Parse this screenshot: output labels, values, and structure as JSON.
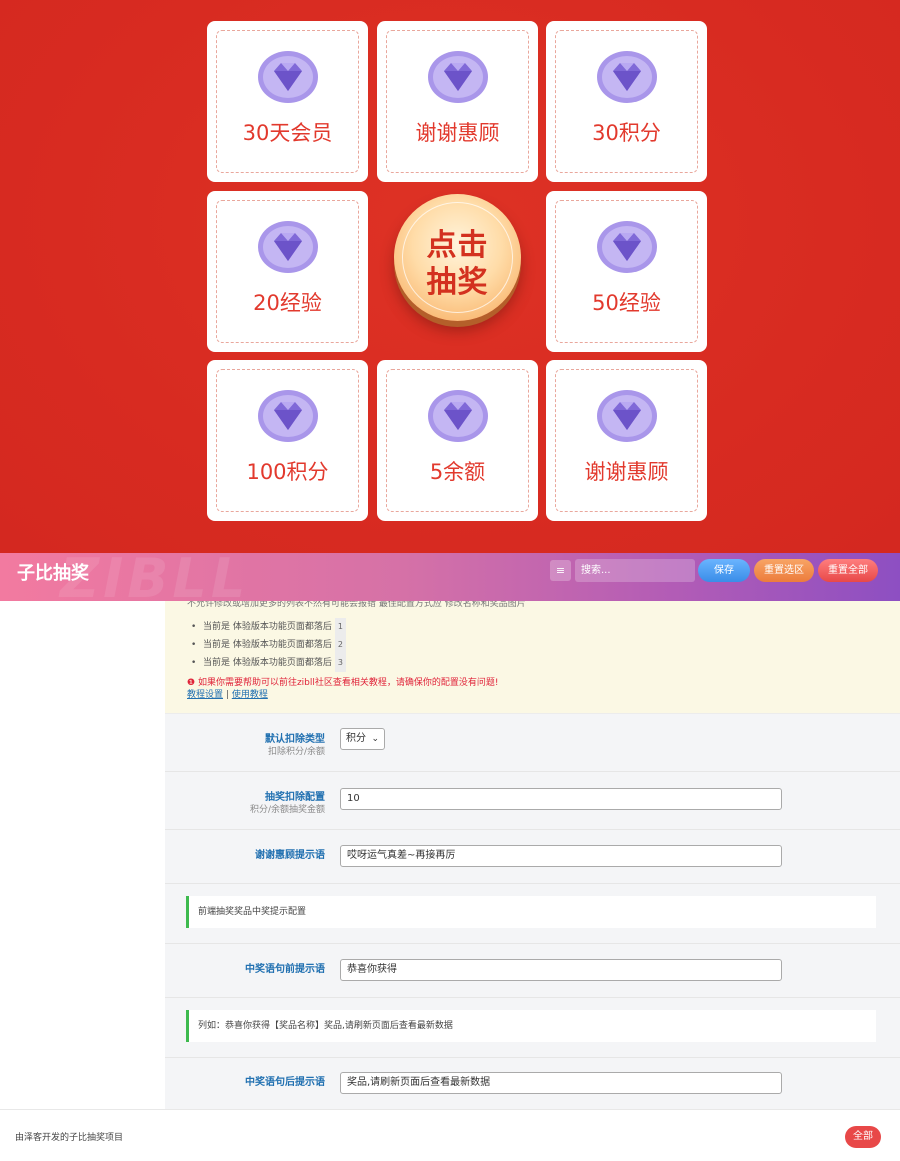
{
  "lottery": {
    "prizes": [
      "30天会员",
      "谢谢惠顾",
      "30积分",
      "20经验",
      "50经验",
      "100积分",
      "5余额",
      "谢谢惠顾"
    ],
    "draw_button": {
      "line1": "点击",
      "line2": "抽奖"
    },
    "icon": "gem-icon",
    "colors": {
      "background": "#d82b21",
      "prize_text": "#e2392d",
      "gem": "#8a7ae0"
    }
  },
  "header": {
    "title": "子比抽奖",
    "watermark": "ZIBLL",
    "menu_icon": "≡",
    "search_placeholder": "搜索...",
    "save": "保存",
    "reset_section": "重置选区",
    "reset_all": "重置全部"
  },
  "notice": {
    "top_line": "不允许修改或增加更多的列表不然有可能会报错 最佳配置方式应 修改名称和奖品图片",
    "items": [
      {
        "text": "当前是 体验版本功能页面都落后",
        "num": "1"
      },
      {
        "text": "当前是 体验版本功能页面都落后",
        "num": "2"
      },
      {
        "text": "当前是 体验版本功能页面都落后",
        "num": "3"
      }
    ],
    "warning": "如果你需要帮助可以前往zibll社区查看相关教程，请确保你的配置没有问题!",
    "link1": "教程设置",
    "separator": "|",
    "link2": "使用教程"
  },
  "settings": {
    "deduct_type": {
      "label": "默认扣除类型",
      "sub": "扣除积分/余额",
      "value": "积分"
    },
    "deduct_config": {
      "label": "抽奖扣除配置",
      "sub": "积分/余额抽奖金额",
      "value": "10"
    },
    "thanks_tip": {
      "label": "谢谢惠顾提示语",
      "value": "哎呀运气真差~再接再厉"
    },
    "info1": "前端抽奖奖品中奖提示配置",
    "prefix_tip": {
      "label": "中奖语句前提示语",
      "value": "恭喜你获得"
    },
    "info2": "列如：恭喜你获得【奖品名称】奖品,请刷新页面后查看最新数据",
    "suffix_tip": {
      "label": "中奖语句后提示语",
      "value": "奖品,请刷新页面后查看最新数据"
    }
  },
  "footer": {
    "text": "由泽客开发的子比抽奖项目",
    "float_button": "全部"
  }
}
